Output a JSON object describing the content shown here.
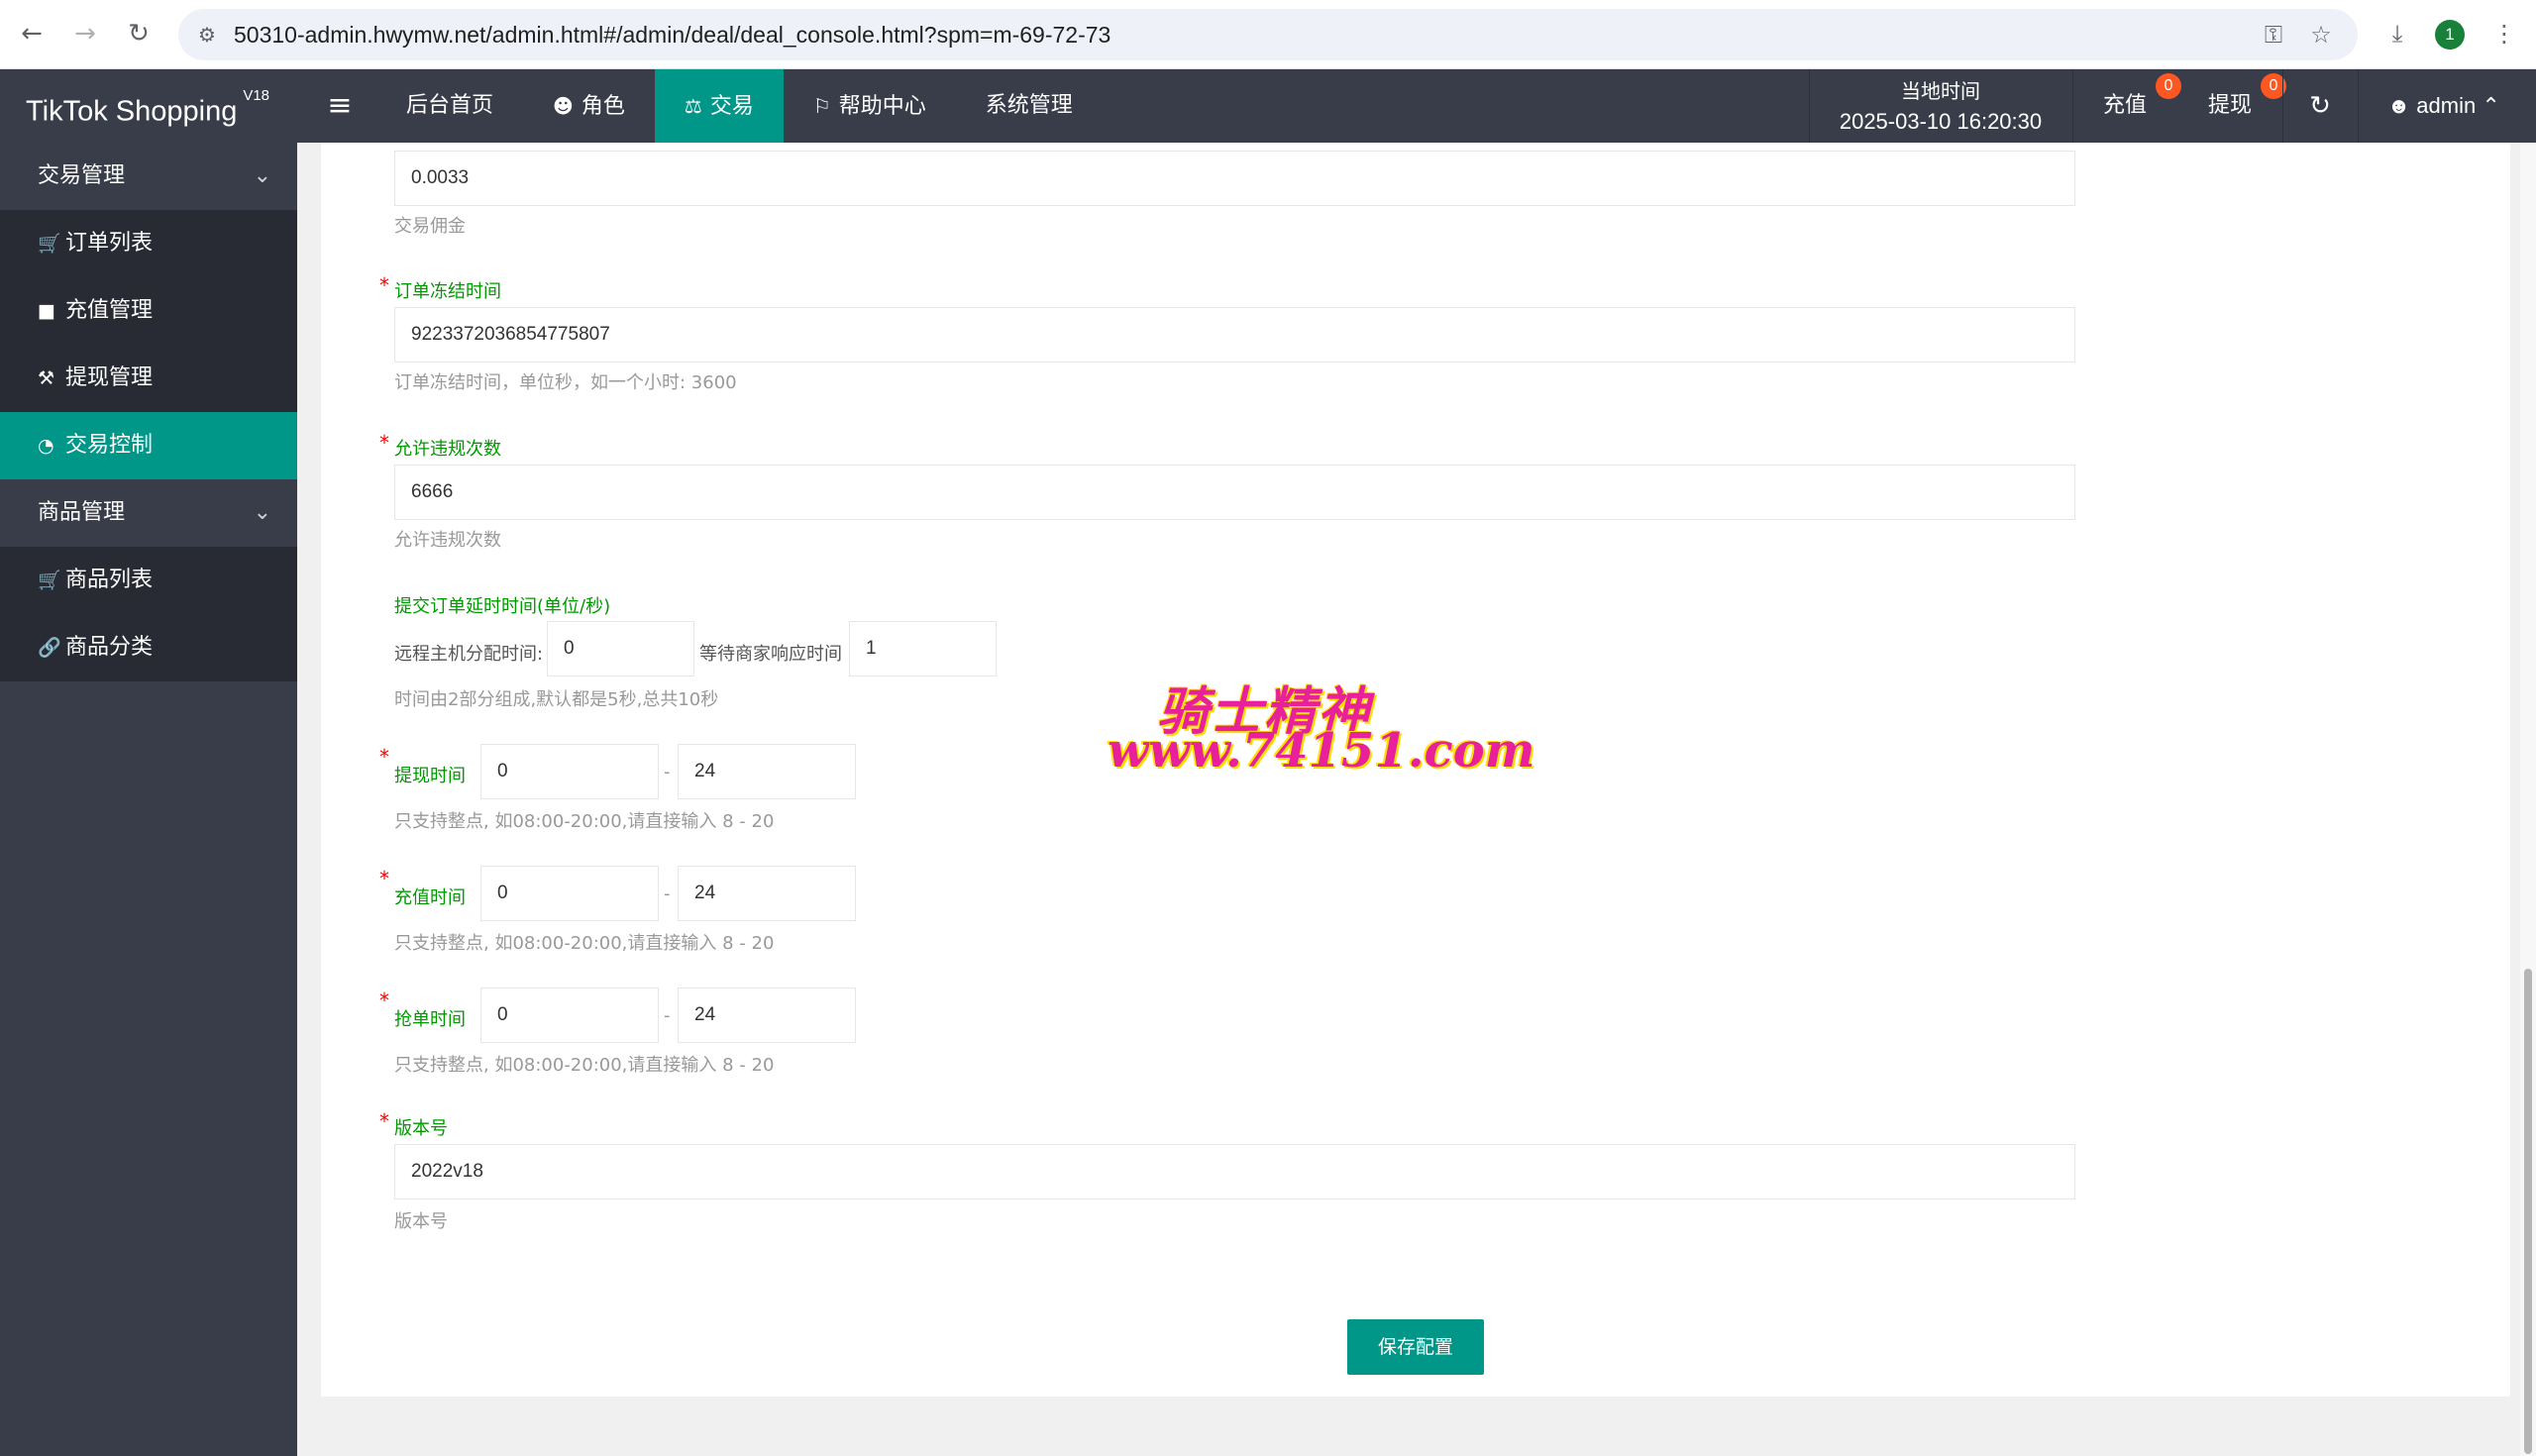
{
  "browser": {
    "url": "50310-admin.hwymw.net/admin.html#/admin/deal/deal_console.html?spm=m-69-72-73",
    "profile_initial": "1"
  },
  "header": {
    "logo": "TikTok Shopping",
    "logo_version": "V18",
    "nav": [
      {
        "label": "后台首页",
        "icon": ""
      },
      {
        "label": "角色",
        "icon": "user-icon"
      },
      {
        "label": "交易",
        "icon": "scale-icon",
        "active": true
      },
      {
        "label": "帮助中心",
        "icon": "flag-icon"
      },
      {
        "label": "系统管理",
        "icon": ""
      }
    ],
    "local_time_label": "当地时间",
    "local_time_value": "2025-03-10 16:20:30",
    "recharge_label": "充值",
    "recharge_badge": "0",
    "withdraw_label": "提现",
    "withdraw_badge": "0",
    "user": "admin"
  },
  "sidebar": {
    "groups": [
      {
        "label": "交易管理",
        "items": [
          {
            "label": "订单列表",
            "icon": "cart-icon"
          },
          {
            "label": "充值管理",
            "icon": "chat-icon"
          },
          {
            "label": "提现管理",
            "icon": "gavel-icon"
          },
          {
            "label": "交易控制",
            "icon": "dashboard-icon",
            "active": true
          }
        ]
      },
      {
        "label": "商品管理",
        "items": [
          {
            "label": "商品列表",
            "icon": "cart-icon"
          },
          {
            "label": "商品分类",
            "icon": "link-icon"
          }
        ]
      }
    ]
  },
  "form": {
    "commission": {
      "value": "0.0033",
      "hint": "交易佣金"
    },
    "freeze_time": {
      "label": "订单冻结时间",
      "value": "9223372036854775807",
      "hint": "订单冻结时间，单位秒，如一个小时: 3600"
    },
    "violations": {
      "label": "允许违规次数",
      "value": "6666",
      "hint": "允许违规次数"
    },
    "submit_delay": {
      "label": "提交订单延时时间(单位/秒)",
      "remote_label": "远程主机分配时间:",
      "remote_value": "0",
      "merchant_label": "等待商家响应时间",
      "merchant_value": "1",
      "hint": "时间由2部分组成,默认都是5秒,总共10秒"
    },
    "withdraw_time": {
      "label": "提现时间",
      "from": "0",
      "to": "24",
      "hint": "只支持整点, 如08:00-20:00,请直接输入 8 - 20"
    },
    "recharge_time": {
      "label": "充值时间",
      "from": "0",
      "to": "24",
      "hint": "只支持整点, 如08:00-20:00,请直接输入 8 - 20"
    },
    "grab_time": {
      "label": "抢单时间",
      "from": "0",
      "to": "24",
      "hint": "只支持整点, 如08:00-20:00,请直接输入 8 - 20"
    },
    "version": {
      "label": "版本号",
      "value": "2022v18",
      "hint": "版本号"
    },
    "range_separator": "-",
    "required_mark": "*",
    "save_label": "保存配置"
  },
  "watermark": {
    "line1": "骑士精神",
    "line2": "www.74151.com"
  }
}
